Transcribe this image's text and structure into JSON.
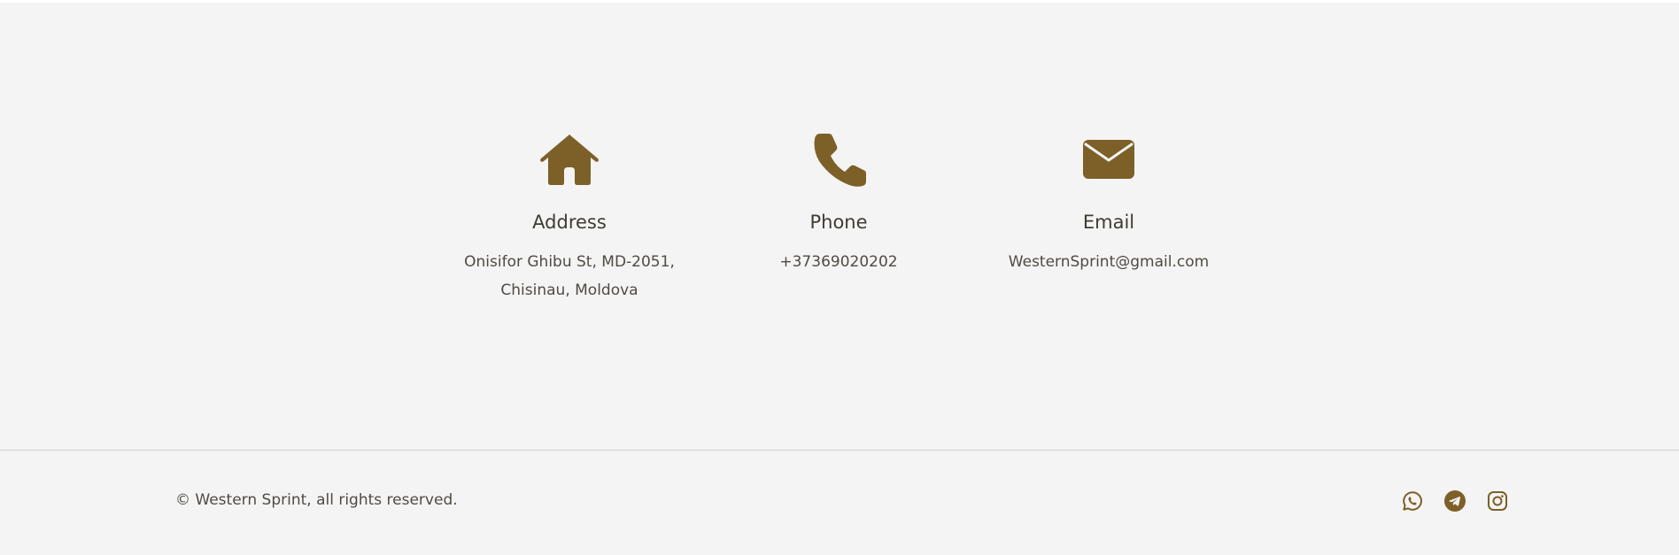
{
  "brand_color": "#7d6028",
  "contacts": {
    "address": {
      "icon": "house-icon",
      "title": "Address",
      "line1": "Onisifor Ghibu St, MD-2051,",
      "line2": "Chisinau, Moldova"
    },
    "phone": {
      "icon": "phone-icon",
      "title": "Phone",
      "value": "+37369020202"
    },
    "email": {
      "icon": "envelope-icon",
      "title": "Email",
      "value": "WesternSprint@gmail.com"
    }
  },
  "footer": {
    "copyright": "© Western Sprint, all rights reserved.",
    "social": [
      {
        "icon": "whatsapp-icon"
      },
      {
        "icon": "telegram-icon"
      },
      {
        "icon": "instagram-icon"
      }
    ]
  }
}
